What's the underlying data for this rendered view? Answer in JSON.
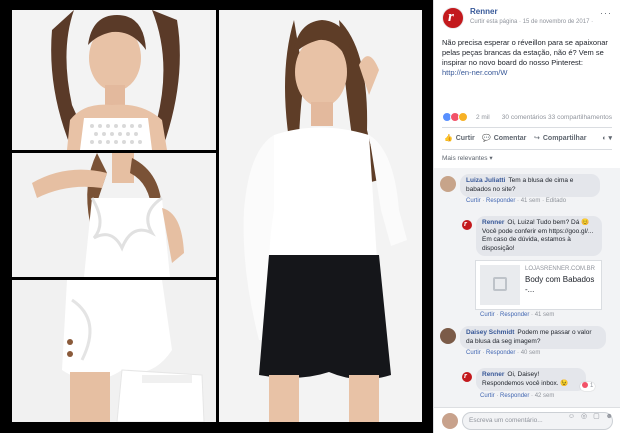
{
  "post": {
    "page_name": "Renner",
    "subtitle": "Curtir esta página · 15 de novembro de 2017 · ",
    "more": "···",
    "text": "Não precisa esperar o réveillon para se apaixonar pelas peças brancas da estação, não é? Vem se inspirar no novo board do nosso Pinterest: ",
    "link": "http://en-ner.com/W"
  },
  "reactions": {
    "count": "2 mil",
    "stats": "30 comentários  33 compartilhamentos"
  },
  "actions": {
    "like": "Curtir",
    "comment": "Comentar",
    "share": "Compartilhar",
    "like_icon": "thumbs-up-icon",
    "comment_icon": "speech-bubble-icon",
    "share_icon": "share-arrow-icon"
  },
  "relevant_label": "Mais relevantes ▾",
  "comments": [
    {
      "name": "Luiza Juliatti",
      "text": "Tem a blusa de cima e babados no site?",
      "meta_like": "Curtir",
      "meta_reply": "Responder",
      "meta_time": "41 sem",
      "meta_edited": "Editado"
    },
    {
      "name": "Renner",
      "text": "Oi, Luiza! Tudo bem? Dá 😊 Você pode conferir em https://goo.gl/... Em caso de dúvida, estamos à disposição!",
      "meta_like": "Curtir",
      "meta_reply": "Responder",
      "meta_time": "41 sem"
    },
    {
      "name": "Daisey Schmidt",
      "text": "Podem me passar o valor da blusa da seg imagem?",
      "meta_like": "Curtir",
      "meta_reply": "Responder",
      "meta_time": "40 sem"
    },
    {
      "name": "Renner",
      "text": "Oi, Daisey! Respondemos você inbox. 😉",
      "meta_like": "Curtir",
      "meta_reply": "Responder",
      "meta_time": "42 sem",
      "reaction_count": "1"
    }
  ],
  "preview": {
    "domain": "LOJASRENNER.COM.BR",
    "title": "Body com Babados -..."
  },
  "composer": {
    "placeholder": "Escreva um comentário...",
    "icons": "☺ ◎ ▢ ☻"
  },
  "colors": {
    "brand": "#c3191d",
    "link": "#385898",
    "panel_bg": "#ffffff",
    "comments_bg": "#f2f3f5"
  }
}
